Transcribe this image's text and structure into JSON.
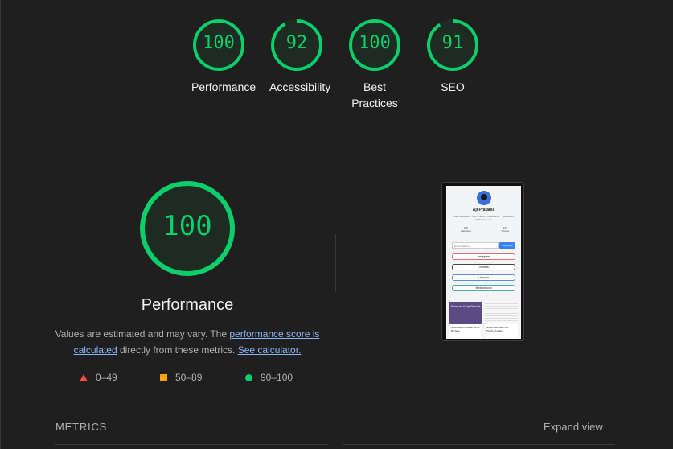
{
  "colors": {
    "pass": "#0cce6b",
    "average": "#ffa400",
    "fail": "#ff4e42",
    "link": "#8ab4f8"
  },
  "gauges": [
    {
      "score": "100",
      "label": "Performance",
      "fraction": 1.0
    },
    {
      "score": "92",
      "label": "Accessibility",
      "fraction": 0.92
    },
    {
      "score": "100",
      "label": "Best Practices",
      "fraction": 1.0
    },
    {
      "score": "91",
      "label": "SEO",
      "fraction": 0.91
    }
  ],
  "main": {
    "score": "100",
    "title": "Performance",
    "desc_text1": "Values are estimated and may vary. The ",
    "desc_link1": "performance score is calculated",
    "desc_text2": " directly from these metrics. ",
    "desc_link2": "See calculator."
  },
  "legend": [
    {
      "icon": "red-triangle-icon",
      "range": "0–49"
    },
    {
      "icon": "orange-square-icon",
      "range": "50–89"
    },
    {
      "icon": "green-circle-icon",
      "range": "90–100"
    }
  ],
  "screenshot": {
    "name": "Aji Pratama",
    "bio": "Web Developer · Dev Creator · Practitioner · Sponsored by Medium.com",
    "stats": [
      {
        "value": "206",
        "label": "Followers"
      },
      {
        "value": "213",
        "label": "Thread"
      }
    ],
    "email_placeholder": "Email address",
    "subscribe": "Subscribe",
    "links": [
      "Instagram",
      "Threads",
      "LinkedIn",
      "Medium.com"
    ],
    "cards": [
      "(Pra order) Panduan Kerja Remote",
      "Notion Template Job Posting Tracker"
    ],
    "card_banner": "Panduan Kerja Remote"
  },
  "metrics": {
    "label": "METRICS",
    "expand": "Expand view"
  }
}
